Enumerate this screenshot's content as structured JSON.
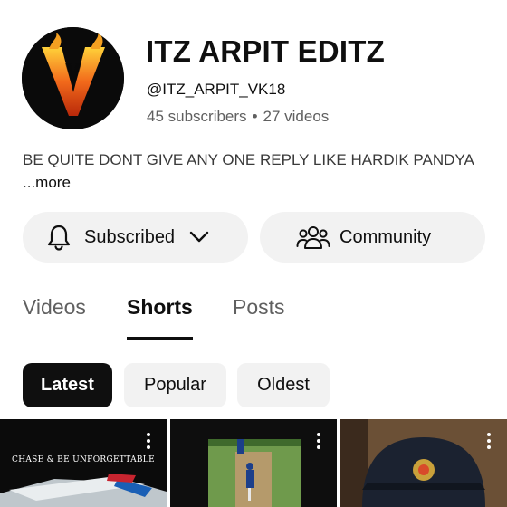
{
  "channel": {
    "name": "ITZ ARPIT EDITZ",
    "handle": "@ITZ_ARPIT_VK18",
    "subscribers": "45 subscribers",
    "separator": "•",
    "videos": "27 videos",
    "avatar_icon": "flaming-v-logo",
    "description": "BE QUITE DONT GIVE ANY ONE REPLY LIKE HARDIK PANDYA",
    "more_label": "...more"
  },
  "actions": {
    "subscribed_label": "Subscribed",
    "subscribed_icon": "bell-icon",
    "community_label": "Community",
    "community_icon": "people-icon"
  },
  "tabs": [
    {
      "label": "Videos",
      "active": false
    },
    {
      "label": "Shorts",
      "active": true
    },
    {
      "label": "Posts",
      "active": false
    }
  ],
  "filters": [
    {
      "label": "Latest",
      "selected": true
    },
    {
      "label": "Popular",
      "selected": false
    },
    {
      "label": "Oldest",
      "selected": false
    }
  ],
  "shorts": [
    {
      "overlay_text": "CHASE & BE UNFORGETTABLE",
      "menu_icon": "more-vert-icon"
    },
    {
      "overlay_text": "",
      "menu_icon": "more-vert-icon"
    },
    {
      "overlay_text": "",
      "menu_icon": "more-vert-icon"
    }
  ],
  "colors": {
    "text_primary": "#0f0f0f",
    "text_secondary": "#606060",
    "chip_bg": "#f2f2f2",
    "chip_selected_bg": "#0f0f0f",
    "flame_orange": "#f26a1b"
  }
}
